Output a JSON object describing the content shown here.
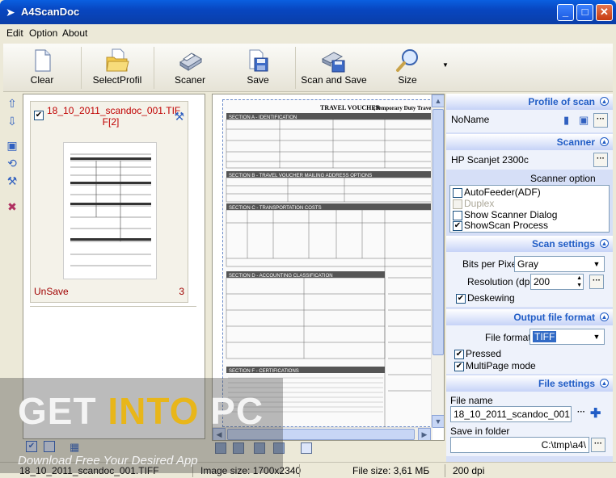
{
  "window": {
    "title": "A4ScanDoc"
  },
  "menu": [
    "Edit",
    "Option",
    "About"
  ],
  "toolbar": {
    "clear": "Clear",
    "select_profil": "SelectProfil",
    "scaner": "Scaner",
    "save": "Save",
    "scan_and_save": "Scan and Save",
    "size": "Size"
  },
  "thumbnail": {
    "name": "18_10_2011_scandoc_001.TIF F[2]",
    "status": "UnSave",
    "count": "3"
  },
  "profile": {
    "header": "Profile of scan",
    "value": "NoName"
  },
  "scanner": {
    "header": "Scanner",
    "value": "HP Scanjet 2300c"
  },
  "scanner_option": {
    "header": "Scanner option",
    "items": [
      {
        "label": "AutoFeeder(ADF)",
        "checked": false,
        "enabled": true
      },
      {
        "label": "Duplex",
        "checked": false,
        "enabled": false
      },
      {
        "label": "Show Scanner Dialog",
        "checked": false,
        "enabled": true
      },
      {
        "label": "ShowScan Process",
        "checked": true,
        "enabled": true
      }
    ]
  },
  "scan_settings": {
    "header": "Scan settings",
    "bits_label": "Bits per Pixel",
    "bits_value": "Gray",
    "resolution_label": "Resolution (dpi)",
    "resolution_value": "200",
    "deskewing": "Deskewing"
  },
  "output": {
    "header": "Output file format",
    "format_label": "File format",
    "format_value": "TIFF",
    "pressed": "Pressed",
    "multipage": "MultiPage mode"
  },
  "file_settings": {
    "header": "File settings",
    "file_name_label": "File name",
    "file_name_value": "18_10_2011_scandoc_001",
    "save_in_label": "Save in  folder",
    "save_in_value": "C:\\tmp\\a4\\"
  },
  "status": {
    "file": "18_10_2011_scandoc_001.TIFF",
    "image_size": "Image size: 1700x2340",
    "file_size": "File size: 3,61 МБ",
    "dpi": "200 dpi"
  },
  "watermark": {
    "line1a": "GET ",
    "line1b": "INTO",
    "line1c": " PC",
    "line2": "Download Free Your Desired App"
  },
  "document": {
    "title": "TRAVEL VOUCHER",
    "subtitle": "(Temporary Duty Travel)",
    "sections": [
      "SECTION A - IDENTIFICATION",
      "SECTION B - TRAVEL VOUCHER MAILING ADDRESS OPTIONS",
      "SECTION C - TRANSPORTATION COSTS",
      "SECTION D - ACCOUNTING CLASSIFICATION",
      "SECTION F - CERTIFICATIONS"
    ]
  },
  "colors": {
    "accent": "#215dc6",
    "title_bar": "#0a4fd0",
    "unsaved": "#c00000"
  }
}
